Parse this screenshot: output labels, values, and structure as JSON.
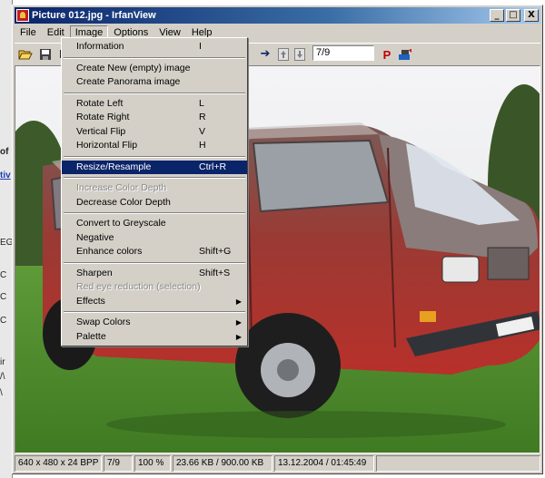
{
  "window": {
    "title": "Picture 012.jpg - IrfanView",
    "buttons": {
      "minimize": "_",
      "maximize": "□",
      "close": "X"
    }
  },
  "background_window": {
    "fragments": [
      "of",
      "tiv",
      "EG",
      "C",
      "C",
      "C",
      "ir",
      "/\\",
      "\\"
    ]
  },
  "menubar": [
    "File",
    "Edit",
    "Image",
    "Options",
    "View",
    "Help"
  ],
  "toolbar": {
    "icons": [
      "open-icon",
      "save-icon",
      "slideshow-icon",
      "thumbnail-icon",
      "cut-icon",
      "undo-icon",
      "rotate-left-icon",
      "rotate-right-icon",
      "zoom-icon",
      "info-icon",
      "prev-icon",
      "next-icon",
      "first-icon",
      "last-icon"
    ],
    "page_field": "7/9",
    "paint_label": "P"
  },
  "image_menu": {
    "items": [
      {
        "label": "Information",
        "shortcut": "I",
        "disabled": false
      },
      {
        "sep": true
      },
      {
        "label": "Create New (empty) image",
        "shortcut": "",
        "disabled": false
      },
      {
        "label": "Create Panorama image",
        "shortcut": "",
        "disabled": false
      },
      {
        "sep": true
      },
      {
        "label": "Rotate Left",
        "shortcut": "L",
        "disabled": false
      },
      {
        "label": "Rotate Right",
        "shortcut": "R",
        "disabled": false
      },
      {
        "label": "Vertical Flip",
        "shortcut": "V",
        "disabled": false
      },
      {
        "label": "Horizontal Flip",
        "shortcut": "H",
        "disabled": false
      },
      {
        "sep": true
      },
      {
        "label": "Resize/Resample",
        "shortcut": "Ctrl+R",
        "disabled": false,
        "highlighted": true
      },
      {
        "sep": true
      },
      {
        "label": "Increase Color Depth",
        "shortcut": "",
        "disabled": true
      },
      {
        "label": "Decrease Color Depth",
        "shortcut": "",
        "disabled": false
      },
      {
        "sep": true
      },
      {
        "label": "Convert to Greyscale",
        "shortcut": "",
        "disabled": false
      },
      {
        "label": "Negative",
        "shortcut": "",
        "disabled": false
      },
      {
        "label": "Enhance colors",
        "shortcut": "Shift+G",
        "disabled": false
      },
      {
        "sep": true
      },
      {
        "label": "Sharpen",
        "shortcut": "Shift+S",
        "disabled": false
      },
      {
        "label": "Red eye reduction (selection)",
        "shortcut": "",
        "disabled": true
      },
      {
        "label": "Effects",
        "shortcut": "",
        "disabled": false,
        "submenu": true
      },
      {
        "sep": true
      },
      {
        "label": "Swap Colors",
        "shortcut": "",
        "disabled": false,
        "submenu": true
      },
      {
        "label": "Palette",
        "shortcut": "",
        "disabled": false,
        "submenu": true
      }
    ]
  },
  "statusbar": {
    "dimensions": "640 x 480 x 24 BPP",
    "index": "7/9",
    "zoom": "100 %",
    "size": "23.66 KB / 900.00 KB",
    "datetime": "13.12.2004 / 01:45:49"
  },
  "colors": {
    "titlebar": "#0a246a",
    "menu_highlight": "#0a246a",
    "chrome": "#d4d0c8",
    "van_red": "#a82e2a",
    "grass": "#4f8a2e"
  }
}
